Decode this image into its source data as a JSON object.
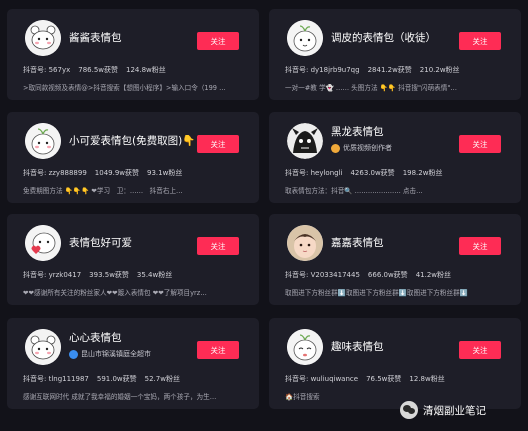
{
  "cards": [
    {
      "name": "酱酱表情包",
      "badge": "",
      "follow": "关注",
      "stats": [
        "抖音号: 567yx",
        "786.5w获赞",
        "124.8w粉丝"
      ],
      "bio": ">取同款视频及表情@>抖音搜索【想图小程序】>输入口令（199 …"
    },
    {
      "name": "调皮的表情包（收徒）",
      "badge": "",
      "follow": "关注",
      "stats": [
        "抖音号: dy18jrb9u7qg",
        "2841.2w获赞",
        "210.2w粉丝"
      ],
      "bio": "一对一#教 学👻 …… 头图方法 👇👇 抖音搜\"闪萌表情\"…"
    },
    {
      "name": "小可爱表情包(免费取图)👇👇",
      "badge": "",
      "follow": "关注",
      "stats": [
        "抖音号: zzy888899",
        "1049.9w获赞",
        "93.1w粉丝"
      ],
      "bio": "免费期图方法 👇👇👇 ❤学习　卫：……　抖音右上…"
    },
    {
      "name": "黑龙表情包",
      "badge": "优质视频创作者",
      "follow": "关注",
      "stats": [
        "抖音号: heylongli",
        "4263.0w获赞",
        "198.2w粉丝"
      ],
      "bio": "取表情包方法：抖音🔍 ………………… 点击…"
    },
    {
      "name": "表情包好可爱",
      "badge": "",
      "follow": "关注",
      "stats": [
        "抖音号: yrzk0417",
        "393.5w获赞",
        "35.4w粉丝"
      ],
      "bio": "❤❤感谢所有关注的粉丝家人❤❤踱入表情包 ❤❤了解项目yrz…"
    },
    {
      "name": "嘉嘉表情包",
      "badge": "",
      "follow": "关注",
      "stats": [
        "抖音号: V2033417445",
        "666.0w获赞",
        "41.2w粉丝"
      ],
      "bio": "取图进下方粉丝群⬇️取图进下方粉丝群⬇️取图进下方粉丝群⬇️"
    },
    {
      "name": "心心表情包",
      "badge": "昆山市锦溪镇庭全超市",
      "follow": "关注",
      "stats": [
        "抖音号: tlng111987",
        "591.0w获赞",
        "52.7w粉丝"
      ],
      "bio": "感谢互联网时代 成就了我幸福的婚姻一个宝妈，两个孩子，为生…"
    },
    {
      "name": "趣味表情包",
      "badge": "",
      "follow": "关注",
      "stats": [
        "抖音号: wuliuqiwance",
        "76.5w获赞",
        "12.8w粉丝"
      ],
      "bio": "🏠抖音搜索"
    }
  ],
  "watermark": "清烟副业笔记",
  "icons": [
    "bear-avatar-icon",
    "sprout-face-icon",
    "dragon-avatar-icon",
    "baby-photo-icon",
    "wechat-icon"
  ]
}
